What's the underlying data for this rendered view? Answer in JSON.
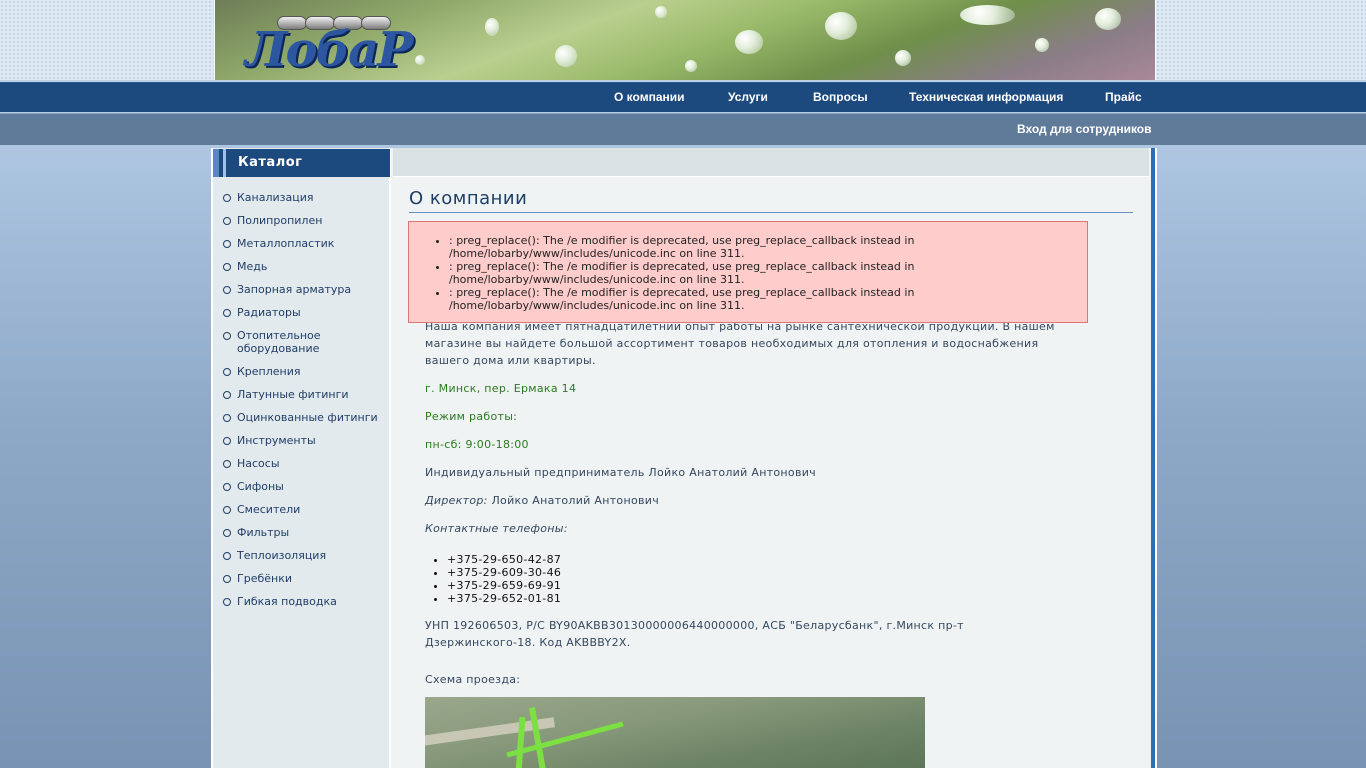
{
  "nav_main": [
    {
      "label": "О компании"
    },
    {
      "label": "Услуги"
    },
    {
      "label": "Вопросы"
    },
    {
      "label": "Техническая информация"
    },
    {
      "label": "Прайс"
    }
  ],
  "nav_secondary": {
    "staff_login": "Вход для сотрудников"
  },
  "sidebar": {
    "title": "Каталог",
    "items": [
      "Канализация",
      "Полипропилен",
      "Металлопластик",
      "Медь",
      "Запорная арматура",
      "Радиаторы",
      "Отопительное оборудование",
      "Крепления",
      "Латунные фитинги",
      "Оцинкованные фитинги",
      "Инструменты",
      "Насосы",
      "Сифоны",
      "Смесители",
      "Фильтры",
      "Теплоизоляция",
      "Гребёнки",
      "Гибкая подводка"
    ]
  },
  "page": {
    "title": "О компании",
    "errors": [
      ": preg_replace(): The /e modifier is deprecated, use preg_replace_callback instead in /home/lobarby/www/includes/unicode.inc on line 311.",
      ": preg_replace(): The /e modifier is deprecated, use preg_replace_callback instead in /home/lobarby/www/includes/unicode.inc on line 311.",
      ": preg_replace(): The /e modifier is deprecated, use preg_replace_callback instead in /home/lobarby/www/includes/unicode.inc on line 311."
    ],
    "intro": "Наша компания имеет пятнадцатилетний опыт работы на рынке сантехнической продукции. В нашем магазине вы найдете большой ассортимент товаров необходимых для отопления и водоснабжения вашего дома или квартиры.",
    "address": "г. Минск, пер. Ермака 14",
    "hours_label": "Режим работы:",
    "hours": "пн-сб: 9:00-18:00",
    "owner": "Индивидуальный предприниматель Лойко Анатолий Антонович",
    "director_label": "Директор:",
    "director_name": "Лойко Анатолий Антонович",
    "phones_label": "Контактные телефоны:",
    "phones": [
      "+375-29-650-42-87",
      "+375-29-609-30-46",
      "+375-29-659-69-91",
      "+375-29-652-01-81"
    ],
    "bank_details": "УНП 192606503, Р/С BY90AKBB30130000006440000000,  АСБ \"Беларусбанк\", г.Минск пр-т Дзержинского-18. Код AKBBBY2X.",
    "map_label": "Схема проезда:"
  },
  "colors": {
    "nav_primary": "#1d4a7e",
    "nav_secondary": "#5f7b99",
    "error_bg": "#ffcccc",
    "text_green": "#2b7a1f"
  }
}
